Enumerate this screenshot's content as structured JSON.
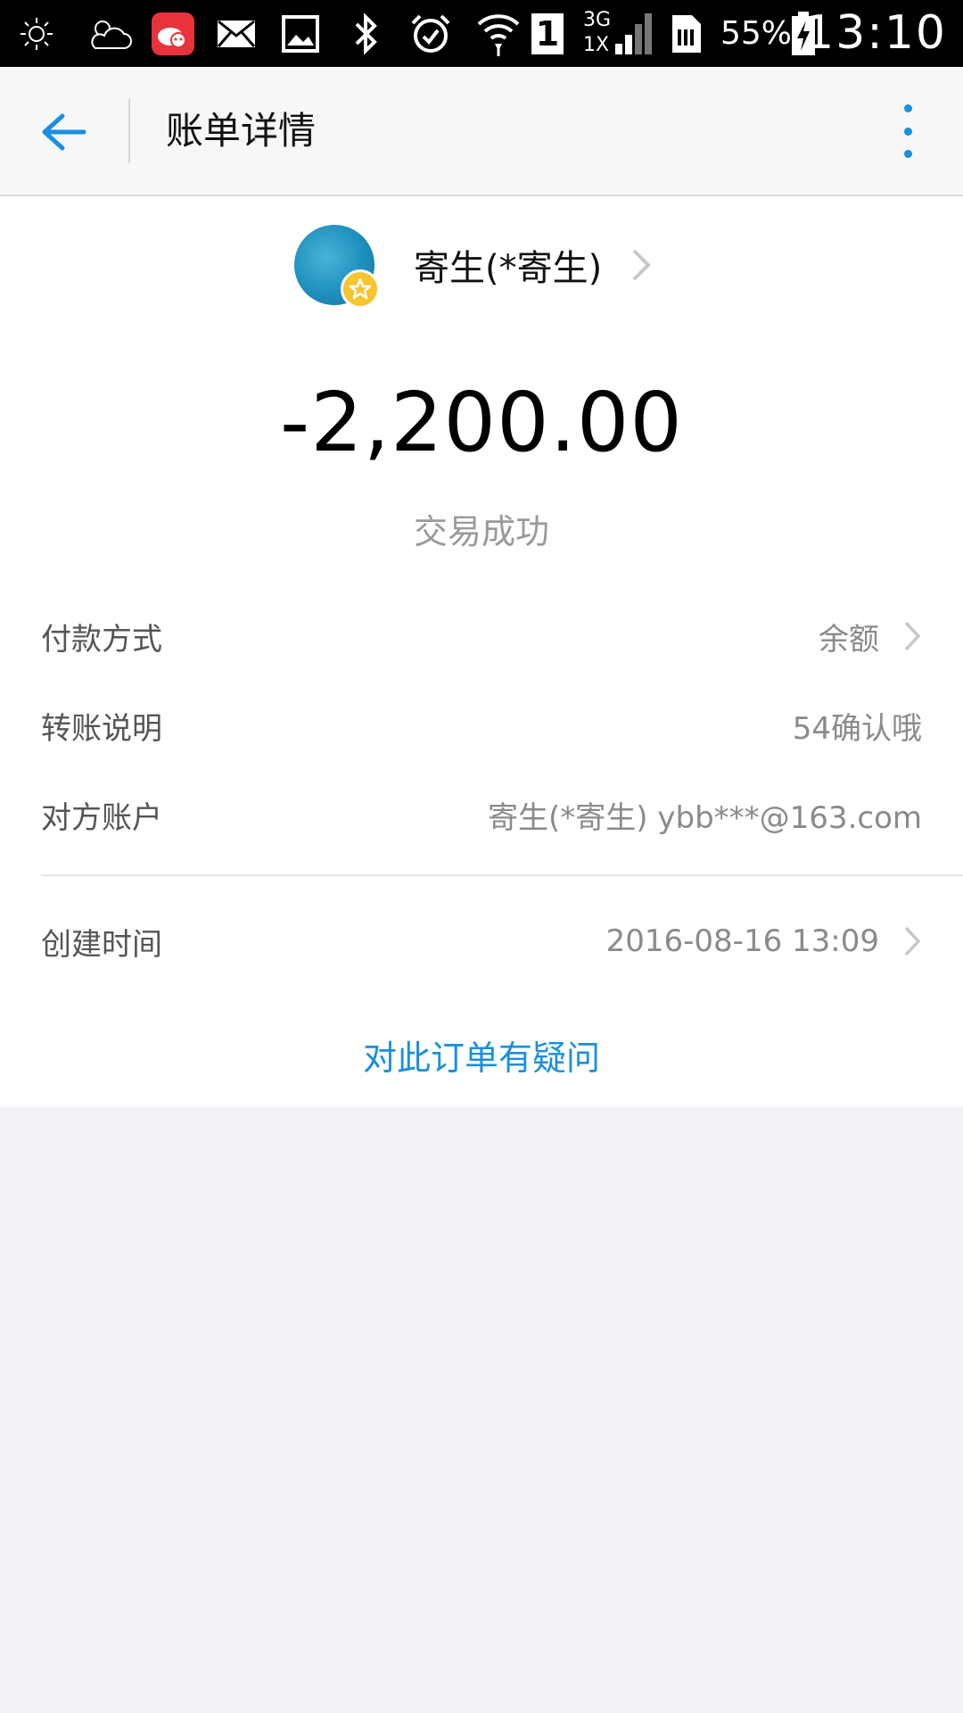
{
  "status_bar": {
    "icons": [
      "brightness-icon",
      "weather-icon",
      "weibo-notification-icon",
      "mail-icon",
      "image-icon",
      "bluetooth-icon",
      "alarm-icon",
      "wifi-icon",
      "sim1-icon",
      "signal-3g-1x-icon",
      "sim-card-icon",
      "battery-charging-icon"
    ],
    "network_top": "3G",
    "network_bottom": "1X",
    "sim_slot": "1",
    "battery": "55%",
    "time": "13:10"
  },
  "app_bar": {
    "title": "账单详情"
  },
  "payee": {
    "name": "寄生(*寄生)"
  },
  "amount": "-2,200.00",
  "status": "交易成功",
  "details": [
    {
      "label": "付款方式",
      "value": "余额",
      "has_chevron": true
    },
    {
      "label": "转账说明",
      "value": "54确认哦",
      "has_chevron": false
    },
    {
      "label": "对方账户",
      "value": "寄生(*寄生) ybb***@163.com",
      "has_chevron": false
    }
  ],
  "created": {
    "label": "创建时间",
    "value": "2016-08-16 13:09",
    "has_chevron": true
  },
  "question_link": "对此订单有疑问",
  "colors": {
    "accent": "#1a8ee0",
    "page_bg": "#f2f2f7",
    "badge": "#f7c431"
  }
}
